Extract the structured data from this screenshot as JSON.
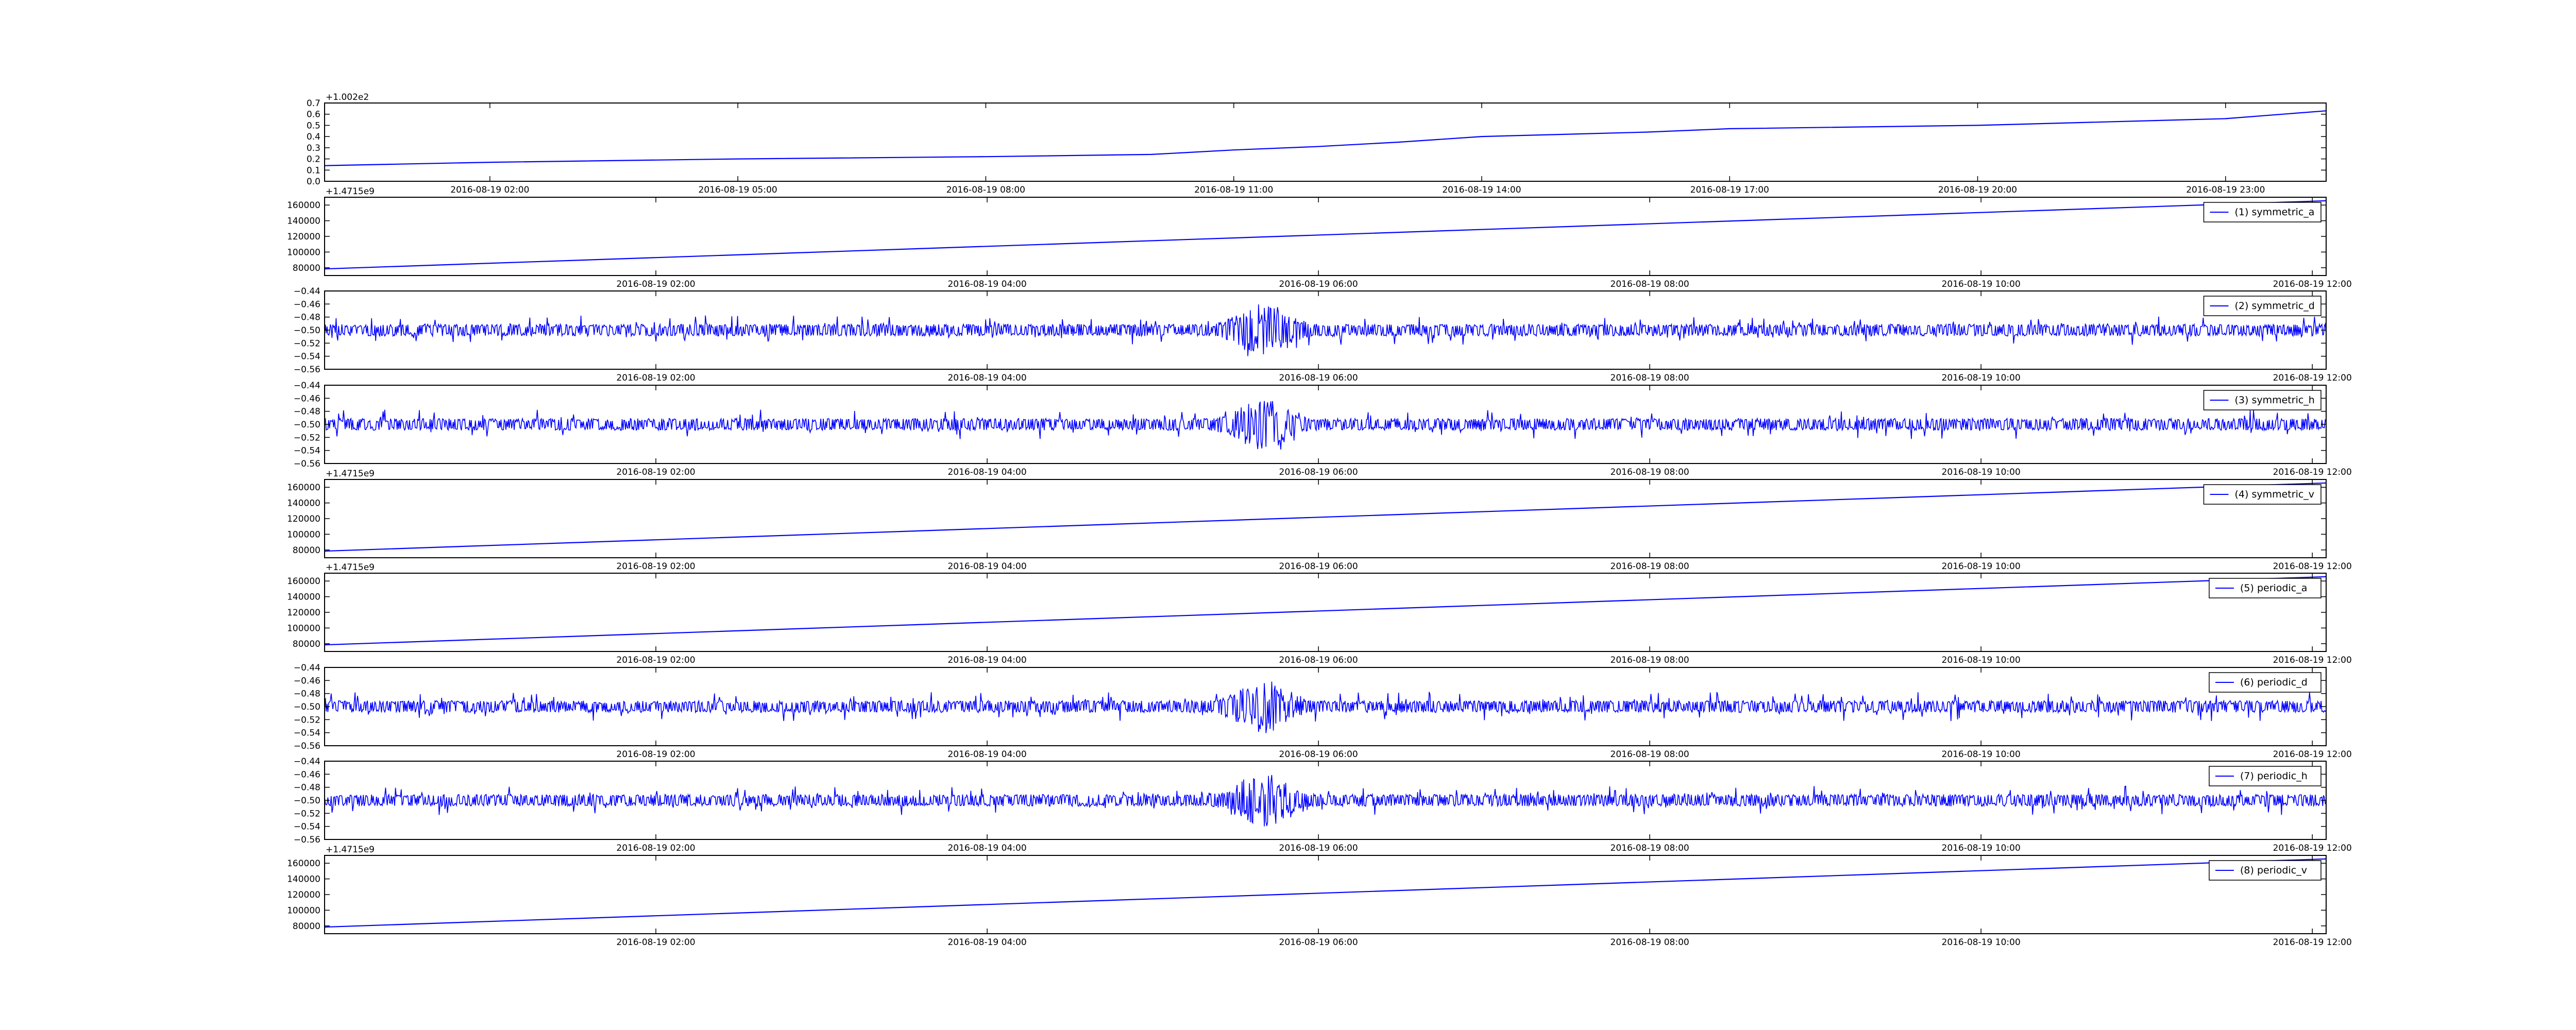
{
  "chart_data": [
    {
      "type": "line",
      "offset_label": "+1.002e2",
      "yticks": [
        "0.0",
        "0.1",
        "0.2",
        "0.3",
        "0.4",
        "0.5",
        "0.6",
        "0.7"
      ],
      "ylim": [
        0.0,
        0.7
      ],
      "xticks": [
        "2016-08-19 02:00",
        "2016-08-19 05:00",
        "2016-08-19 08:00",
        "2016-08-19 11:00",
        "2016-08-19 14:00",
        "2016-08-19 17:00",
        "2016-08-19 20:00",
        "2016-08-19 23:00"
      ],
      "xlim": [
        "2016-08-19 00:00",
        "2016-08-20 00:13"
      ],
      "series": [
        {
          "color": "#0000ff",
          "x": [
            "2016-08-19 00:00",
            "2016-08-19 02:00",
            "2016-08-19 05:00",
            "2016-08-19 08:00",
            "2016-08-19 10:00",
            "2016-08-19 11:00",
            "2016-08-19 12:00",
            "2016-08-19 13:00",
            "2016-08-19 14:00",
            "2016-08-19 16:00",
            "2016-08-19 17:00",
            "2016-08-19 20:00",
            "2016-08-19 23:00",
            "2016-08-20 00:13"
          ],
          "values": [
            0.14,
            0.17,
            0.2,
            0.22,
            0.24,
            0.28,
            0.31,
            0.35,
            0.4,
            0.44,
            0.47,
            0.5,
            0.56,
            0.63
          ]
        }
      ]
    },
    {
      "type": "line",
      "offset_label": "+1.4715e9",
      "legend": "(1) symmetric_a",
      "legend_loc": "upper right",
      "yticks": [
        "80000",
        "100000",
        "120000",
        "140000",
        "160000"
      ],
      "ylim": [
        70000,
        170000
      ],
      "xticks": [
        "2016-08-19 02:00",
        "2016-08-19 04:00",
        "2016-08-19 06:00",
        "2016-08-19 08:00",
        "2016-08-19 10:00",
        "2016-08-19 12:00"
      ],
      "xlim": [
        "2016-08-19 00:00",
        "2016-08-19 12:05"
      ],
      "series": [
        {
          "name": "(1) symmetric_a",
          "color": "#0000ff",
          "x": [
            "2016-08-19 00:00",
            "2016-08-19 12:05"
          ],
          "values": [
            78500,
            165500
          ]
        }
      ]
    },
    {
      "type": "line",
      "legend": "(2) symmetric_d",
      "legend_loc": "upper right",
      "yticks": [
        "−0.56",
        "−0.54",
        "−0.52",
        "−0.50",
        "−0.48",
        "−0.46",
        "−0.44"
      ],
      "ylim": [
        -0.56,
        -0.44
      ],
      "xticks": [
        "2016-08-19 02:00",
        "2016-08-19 04:00",
        "2016-08-19 06:00",
        "2016-08-19 08:00",
        "2016-08-19 10:00",
        "2016-08-19 12:00"
      ],
      "xlim": [
        "2016-08-19 00:00",
        "2016-08-19 12:05"
      ],
      "series": [
        {
          "name": "(2) symmetric_d",
          "color": "#0000ff",
          "baseline": -0.5,
          "typical_amplitude": 0.015,
          "peak_amplitude": 0.05,
          "burst_center": "2016-08-19 05:40",
          "noise_seed": 11
        }
      ]
    },
    {
      "type": "line",
      "legend": "(3) symmetric_h",
      "legend_loc": "upper right",
      "yticks": [
        "−0.56",
        "−0.54",
        "−0.52",
        "−0.50",
        "−0.48",
        "−0.46",
        "−0.44"
      ],
      "ylim": [
        -0.56,
        -0.44
      ],
      "xticks": [
        "2016-08-19 02:00",
        "2016-08-19 04:00",
        "2016-08-19 06:00",
        "2016-08-19 08:00",
        "2016-08-19 10:00",
        "2016-08-19 12:00"
      ],
      "xlim": [
        "2016-08-19 00:00",
        "2016-08-19 12:05"
      ],
      "series": [
        {
          "name": "(3) symmetric_h",
          "color": "#0000ff",
          "baseline": -0.5,
          "typical_amplitude": 0.015,
          "peak_amplitude": 0.05,
          "burst_center": "2016-08-19 05:40",
          "noise_seed": 23
        }
      ]
    },
    {
      "type": "line",
      "offset_label": "+1.4715e9",
      "legend": "(4) symmetric_v",
      "legend_loc": "upper right",
      "yticks": [
        "80000",
        "100000",
        "120000",
        "140000",
        "160000"
      ],
      "ylim": [
        70000,
        170000
      ],
      "xticks": [
        "2016-08-19 02:00",
        "2016-08-19 04:00",
        "2016-08-19 06:00",
        "2016-08-19 08:00",
        "2016-08-19 10:00",
        "2016-08-19 12:00"
      ],
      "xlim": [
        "2016-08-19 00:00",
        "2016-08-19 12:05"
      ],
      "series": [
        {
          "name": "(4) symmetric_v",
          "color": "#0000ff",
          "x": [
            "2016-08-19 00:00",
            "2016-08-19 12:05"
          ],
          "values": [
            78500,
            165500
          ]
        }
      ]
    },
    {
      "type": "line",
      "offset_label": "+1.4715e9",
      "legend": "(5) periodic_a",
      "legend_loc": "upper right",
      "yticks": [
        "80000",
        "100000",
        "120000",
        "140000",
        "160000"
      ],
      "ylim": [
        70000,
        170000
      ],
      "xticks": [
        "2016-08-19 02:00",
        "2016-08-19 04:00",
        "2016-08-19 06:00",
        "2016-08-19 08:00",
        "2016-08-19 10:00",
        "2016-08-19 12:00"
      ],
      "xlim": [
        "2016-08-19 00:00",
        "2016-08-19 12:05"
      ],
      "series": [
        {
          "name": "(5) periodic_a",
          "color": "#0000ff",
          "x": [
            "2016-08-19 00:00",
            "2016-08-19 12:05"
          ],
          "values": [
            78500,
            165500
          ]
        }
      ]
    },
    {
      "type": "line",
      "legend": "(6) periodic_d",
      "legend_loc": "upper right",
      "yticks": [
        "−0.56",
        "−0.54",
        "−0.52",
        "−0.50",
        "−0.48",
        "−0.46",
        "−0.44"
      ],
      "ylim": [
        -0.56,
        -0.44
      ],
      "xticks": [
        "2016-08-19 02:00",
        "2016-08-19 04:00",
        "2016-08-19 06:00",
        "2016-08-19 08:00",
        "2016-08-19 10:00",
        "2016-08-19 12:00"
      ],
      "xlim": [
        "2016-08-19 00:00",
        "2016-08-19 12:05"
      ],
      "series": [
        {
          "name": "(6) periodic_d",
          "color": "#0000ff",
          "baseline": -0.5,
          "typical_amplitude": 0.015,
          "peak_amplitude": 0.05,
          "burst_center": "2016-08-19 05:40",
          "noise_seed": 37
        }
      ]
    },
    {
      "type": "line",
      "legend": "(7) periodic_h",
      "legend_loc": "upper right",
      "yticks": [
        "−0.56",
        "−0.54",
        "−0.52",
        "−0.50",
        "−0.48",
        "−0.46",
        "−0.44"
      ],
      "ylim": [
        -0.56,
        -0.44
      ],
      "xticks": [
        "2016-08-19 02:00",
        "2016-08-19 04:00",
        "2016-08-19 06:00",
        "2016-08-19 08:00",
        "2016-08-19 10:00",
        "2016-08-19 12:00"
      ],
      "xlim": [
        "2016-08-19 00:00",
        "2016-08-19 12:05"
      ],
      "series": [
        {
          "name": "(7) periodic_h",
          "color": "#0000ff",
          "baseline": -0.5,
          "typical_amplitude": 0.015,
          "peak_amplitude": 0.05,
          "burst_center": "2016-08-19 05:40",
          "noise_seed": 53
        }
      ]
    },
    {
      "type": "line",
      "offset_label": "+1.4715e9",
      "legend": "(8) periodic_v",
      "legend_loc": "upper right",
      "yticks": [
        "80000",
        "100000",
        "120000",
        "140000",
        "160000"
      ],
      "ylim": [
        70000,
        170000
      ],
      "xticks": [
        "2016-08-19 02:00",
        "2016-08-19 04:00",
        "2016-08-19 06:00",
        "2016-08-19 08:00",
        "2016-08-19 10:00",
        "2016-08-19 12:00"
      ],
      "xlim": [
        "2016-08-19 00:00",
        "2016-08-19 12:05"
      ],
      "series": [
        {
          "name": "(8) periodic_v",
          "color": "#0000ff",
          "x": [
            "2016-08-19 00:00",
            "2016-08-19 12:05"
          ],
          "values": [
            78500,
            165500
          ]
        }
      ]
    }
  ]
}
